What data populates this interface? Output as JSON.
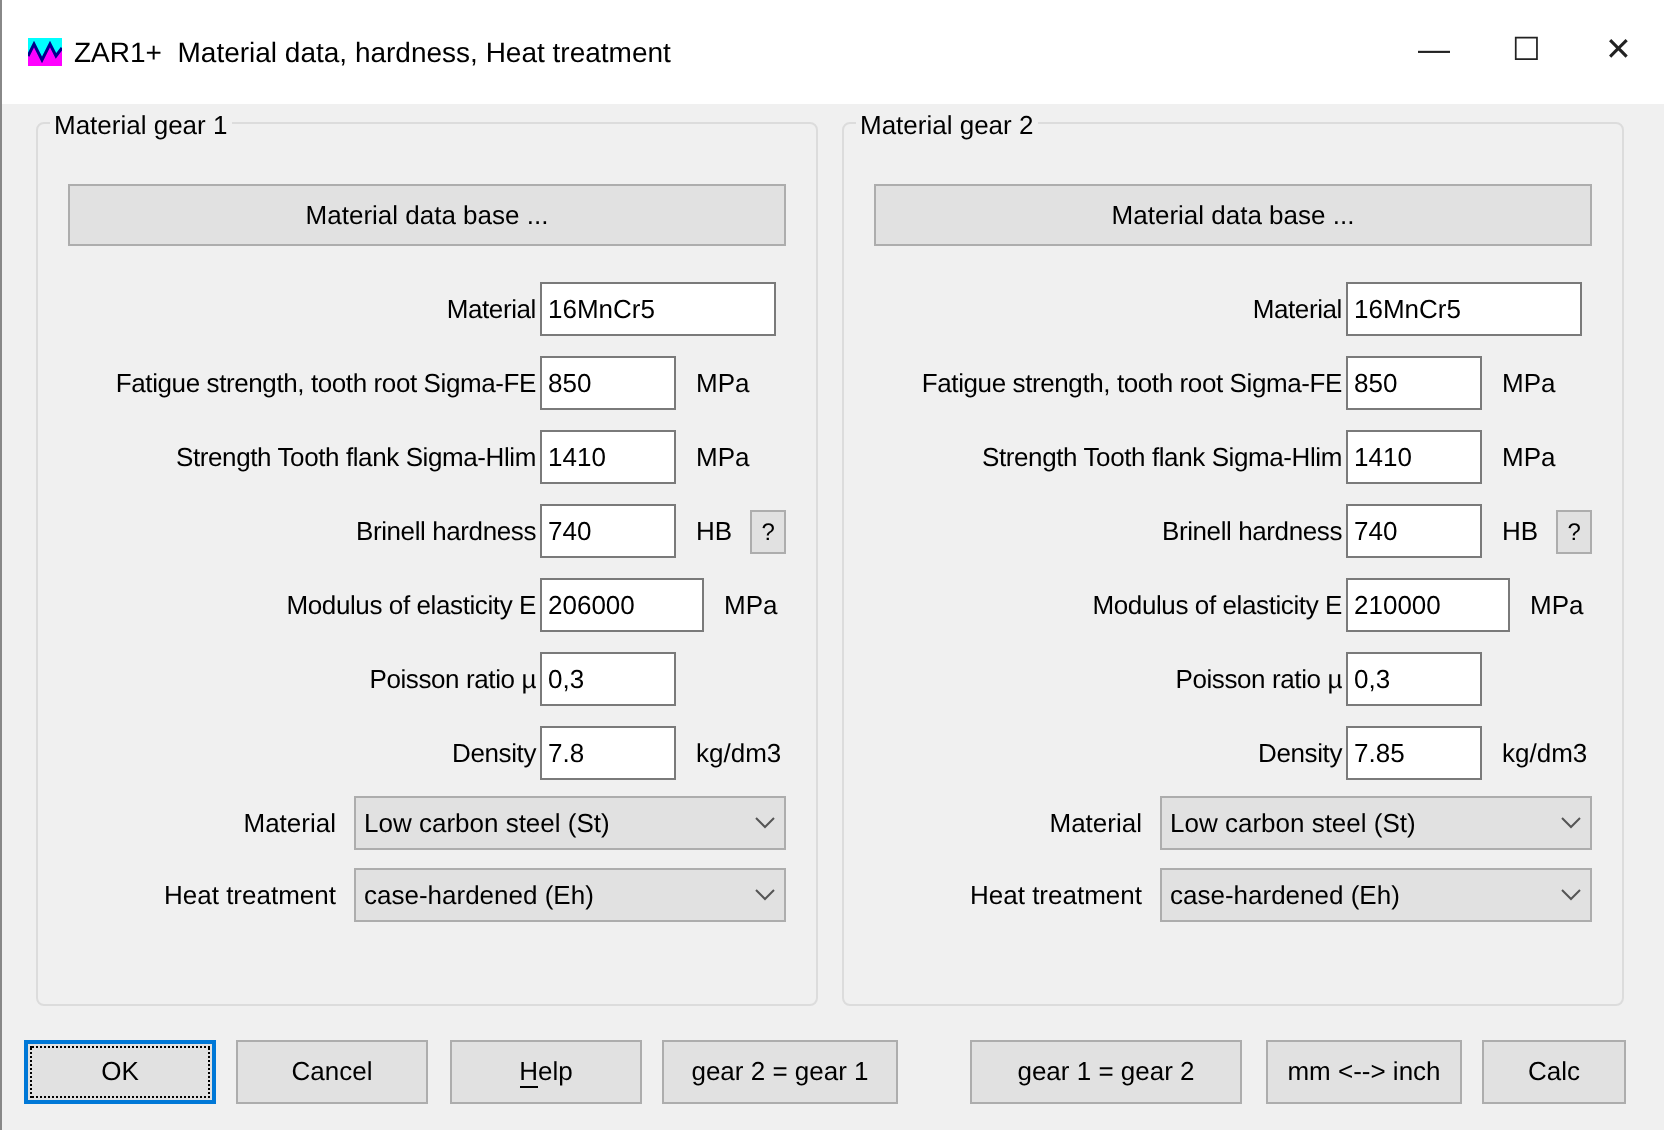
{
  "window": {
    "title": "ZAR1+  Material data, hardness, Heat treatment",
    "controls": [
      "—",
      "☐",
      "✕"
    ]
  },
  "groups": [
    {
      "title": "Material gear 1",
      "database_button": "Material data base ...",
      "fields": [
        {
          "label": "Material",
          "value": "16MnCr5",
          "kind": "wide"
        },
        {
          "label": "Fatigue strength, tooth root Sigma-FE",
          "value": "850",
          "unit": "MPa",
          "kind": "short"
        },
        {
          "label": "Strength Tooth flank Sigma-Hlim",
          "value": "1410",
          "unit": "MPa",
          "kind": "short"
        },
        {
          "label": "Brinell hardness",
          "value": "740",
          "unit": "HB",
          "help": "?",
          "kind": "short"
        },
        {
          "label": "Modulus of elasticity E",
          "value": "206000",
          "unit": "MPa",
          "kind": "medium"
        },
        {
          "label": "Poisson ratio µ",
          "value": "0,3",
          "kind": "short"
        },
        {
          "label": "Density",
          "value": "7.8",
          "unit": "kg/dm3",
          "kind": "short"
        }
      ],
      "dropdowns": [
        {
          "label": "Material",
          "value": "Low carbon steel (St)"
        },
        {
          "label": "Heat treatment",
          "value": "case-hardened (Eh)"
        }
      ]
    },
    {
      "title": "Material gear 2",
      "database_button": "Material data base ...",
      "fields": [
        {
          "label": "Material",
          "value": "16MnCr5",
          "kind": "wide"
        },
        {
          "label": "Fatigue strength, tooth root Sigma-FE",
          "value": "850",
          "unit": "MPa",
          "kind": "short"
        },
        {
          "label": "Strength Tooth flank Sigma-Hlim",
          "value": "1410",
          "unit": "MPa",
          "kind": "short"
        },
        {
          "label": "Brinell hardness",
          "value": "740",
          "unit": "HB",
          "help": "?",
          "kind": "short"
        },
        {
          "label": "Modulus of elasticity E",
          "value": "210000",
          "unit": "MPa",
          "kind": "medium"
        },
        {
          "label": "Poisson ratio µ",
          "value": "0,3",
          "kind": "short"
        },
        {
          "label": "Density",
          "value": "7.85",
          "unit": "kg/dm3",
          "kind": "short"
        }
      ],
      "dropdowns": [
        {
          "label": "Material",
          "value": "Low carbon steel (St)"
        },
        {
          "label": "Heat treatment",
          "value": "case-hardened (Eh)"
        }
      ]
    }
  ],
  "buttons": [
    {
      "label": "OK",
      "focused": true,
      "underline_first": false
    },
    {
      "label": "Cancel",
      "focused": false,
      "underline_first": false
    },
    {
      "label": "Help",
      "focused": false,
      "underline_first": true
    },
    {
      "label": "gear 2 = gear 1",
      "focused": false,
      "underline_first": false
    },
    {
      "label": "gear 1 = gear 2",
      "focused": false,
      "underline_first": false
    },
    {
      "label": "mm <--> inch",
      "focused": false,
      "underline_first": false
    },
    {
      "label": "Calc",
      "focused": false,
      "underline_first": false
    }
  ]
}
